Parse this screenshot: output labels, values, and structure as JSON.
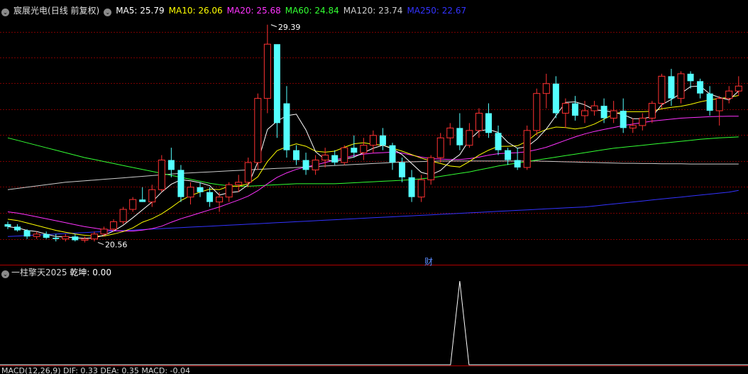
{
  "stock": {
    "name": "宸展光电",
    "period": "(日线 前复权)"
  },
  "ma_legend": [
    {
      "label": "MA5: 25.79",
      "color": "#ffffff"
    },
    {
      "label": "MA10: 26.06",
      "color": "#ffff00"
    },
    {
      "label": "MA20: 25.68",
      "color": "#ff33ff"
    },
    {
      "label": "MA60: 24.84",
      "color": "#33ff33"
    },
    {
      "label": "MA120: 23.74",
      "color": "#cccccc"
    },
    {
      "label": "MA250: 22.67",
      "color": "#3333ff"
    }
  ],
  "indicator": {
    "name": "一柱擎天2025",
    "value_label": "乾坤: 0.00"
  },
  "marker_cai": "财",
  "bottom_legend": "MACD(12,26,9)  DIF: 0.33  DEA: 0.35  MACD: -0.04",
  "colors": {
    "up": "#ff3232",
    "down": "#54ffff",
    "grid": "#7a0000",
    "bg": "#000000"
  },
  "chart_data": {
    "type": "candlestick",
    "ylim": [
      19.8,
      29.7
    ],
    "price_annotations": [
      {
        "label": "29.39",
        "price": 29.39,
        "bar": 27
      },
      {
        "label": "20.56",
        "price": 20.56,
        "bar": 9
      }
    ],
    "ohlc": [
      [
        21.3,
        21.4,
        21.1,
        21.2
      ],
      [
        21.2,
        21.3,
        21.0,
        21.05
      ],
      [
        21.05,
        21.1,
        20.7,
        20.8
      ],
      [
        20.8,
        21.0,
        20.7,
        20.9
      ],
      [
        20.9,
        21.0,
        20.7,
        20.75
      ],
      [
        20.75,
        20.9,
        20.6,
        20.7
      ],
      [
        20.7,
        20.9,
        20.6,
        20.8
      ],
      [
        20.8,
        20.9,
        20.6,
        20.65
      ],
      [
        20.65,
        20.8,
        20.56,
        20.7
      ],
      [
        20.7,
        21.0,
        20.6,
        20.9
      ],
      [
        20.9,
        21.2,
        20.8,
        21.1
      ],
      [
        21.1,
        21.5,
        21.0,
        21.4
      ],
      [
        21.4,
        22.0,
        21.3,
        21.9
      ],
      [
        21.9,
        22.4,
        21.8,
        22.3
      ],
      [
        22.3,
        22.8,
        22.2,
        22.2
      ],
      [
        22.2,
        22.9,
        22.0,
        22.7
      ],
      [
        22.7,
        24.1,
        22.6,
        23.9
      ],
      [
        23.9,
        24.4,
        23.2,
        23.5
      ],
      [
        23.5,
        23.7,
        22.2,
        22.4
      ],
      [
        22.4,
        23.0,
        22.1,
        22.8
      ],
      [
        22.8,
        23.0,
        22.4,
        22.6
      ],
      [
        22.6,
        22.8,
        22.0,
        22.2
      ],
      [
        22.2,
        22.6,
        21.8,
        22.4
      ],
      [
        22.4,
        23.0,
        22.2,
        22.9
      ],
      [
        22.9,
        23.3,
        22.6,
        23.0
      ],
      [
        23.0,
        24.0,
        22.8,
        23.8
      ],
      [
        23.8,
        26.6,
        23.5,
        26.4
      ],
      [
        26.4,
        29.39,
        25.8,
        28.6
      ],
      [
        28.6,
        27.2,
        24.8,
        25.4
      ],
      [
        26.2,
        26.9,
        24.0,
        24.3
      ],
      [
        24.3,
        24.5,
        23.7,
        23.9
      ],
      [
        23.9,
        24.2,
        23.3,
        23.5
      ],
      [
        23.5,
        24.1,
        23.3,
        23.9
      ],
      [
        23.9,
        24.4,
        23.6,
        24.1
      ],
      [
        24.1,
        24.3,
        23.7,
        23.8
      ],
      [
        23.8,
        24.5,
        23.7,
        24.4
      ],
      [
        24.4,
        24.9,
        24.0,
        24.2
      ],
      [
        24.2,
        24.8,
        23.9,
        24.5
      ],
      [
        24.5,
        25.1,
        24.2,
        24.9
      ],
      [
        24.9,
        25.2,
        24.3,
        24.5
      ],
      [
        24.5,
        24.6,
        23.5,
        23.8
      ],
      [
        23.8,
        24.0,
        23.0,
        23.2
      ],
      [
        23.2,
        23.5,
        22.2,
        22.4
      ],
      [
        22.4,
        23.3,
        22.2,
        23.1
      ],
      [
        23.1,
        24.1,
        22.9,
        24.0
      ],
      [
        24.0,
        25.0,
        23.8,
        24.8
      ],
      [
        24.8,
        25.4,
        24.5,
        25.2
      ],
      [
        25.2,
        25.8,
        24.3,
        24.5
      ],
      [
        24.5,
        25.4,
        24.4,
        25.1
      ],
      [
        25.1,
        26.0,
        24.8,
        25.8
      ],
      [
        25.8,
        26.2,
        24.8,
        25.0
      ],
      [
        25.0,
        25.3,
        24.1,
        24.3
      ],
      [
        24.3,
        24.4,
        23.7,
        23.9
      ],
      [
        23.9,
        24.4,
        23.5,
        23.6
      ],
      [
        23.6,
        25.3,
        23.5,
        25.1
      ],
      [
        25.1,
        26.8,
        24.9,
        26.6
      ],
      [
        26.6,
        27.4,
        26.0,
        27.0
      ],
      [
        27.0,
        27.3,
        25.6,
        25.8
      ],
      [
        25.8,
        26.4,
        25.2,
        26.2
      ],
      [
        26.2,
        26.5,
        25.5,
        25.7
      ],
      [
        25.7,
        26.3,
        25.4,
        25.9
      ],
      [
        25.9,
        26.3,
        25.7,
        26.1
      ],
      [
        26.1,
        26.4,
        25.4,
        25.6
      ],
      [
        25.6,
        26.3,
        25.4,
        25.9
      ],
      [
        25.9,
        26.4,
        25.0,
        25.2
      ],
      [
        25.2,
        25.6,
        25.0,
        25.3
      ],
      [
        25.3,
        25.8,
        25.1,
        25.6
      ],
      [
        25.6,
        26.3,
        25.4,
        26.2
      ],
      [
        26.2,
        27.4,
        26.0,
        27.3
      ],
      [
        27.3,
        27.6,
        26.1,
        26.4
      ],
      [
        26.4,
        27.5,
        26.2,
        27.4
      ],
      [
        27.4,
        27.5,
        26.8,
        27.1
      ],
      [
        27.1,
        27.2,
        26.4,
        26.6
      ],
      [
        26.6,
        26.9,
        25.7,
        25.9
      ],
      [
        25.9,
        26.5,
        25.3,
        26.4
      ],
      [
        26.4,
        26.9,
        26.2,
        26.7
      ],
      [
        26.7,
        27.3,
        26.5,
        26.9
      ]
    ],
    "ma5": [
      21.2,
      21.15,
      21.05,
      21.0,
      20.9,
      20.8,
      20.78,
      20.75,
      20.72,
      20.75,
      20.85,
      21.02,
      21.26,
      21.56,
      21.88,
      22.2,
      22.6,
      22.92,
      23.1,
      23.06,
      22.98,
      22.86,
      22.48,
      22.58,
      22.62,
      22.9,
      23.82,
      25.14,
      25.48,
      25.7,
      25.76,
      25.12,
      24.24,
      23.92,
      23.84,
      23.94,
      24.02,
      24.2,
      24.38,
      24.5,
      24.36,
      24.12,
      23.76,
      23.4,
      23.3,
      23.48,
      23.84,
      24.12,
      24.72,
      25.08,
      25.14,
      25.02,
      24.62,
      24.38,
      24.44,
      24.74,
      25.16,
      25.7,
      26.24,
      26.26,
      26.14,
      25.94,
      25.9,
      25.84,
      25.74,
      25.58,
      25.58,
      25.66,
      26.14,
      26.36,
      26.6,
      26.88,
      26.9,
      26.58,
      26.44,
      26.34,
      26.7
    ],
    "ma10": [
      21.5,
      21.45,
      21.35,
      21.25,
      21.15,
      21.05,
      20.97,
      20.9,
      20.85,
      20.82,
      20.82,
      20.9,
      21.0,
      21.15,
      21.38,
      21.52,
      21.72,
      21.98,
      22.26,
      22.46,
      22.6,
      22.72,
      22.7,
      22.84,
      22.84,
      22.94,
      23.22,
      23.84,
      24.28,
      24.44,
      24.56,
      24.46,
      24.26,
      24.22,
      24.26,
      24.42,
      24.56,
      24.6,
      24.54,
      24.5,
      24.38,
      24.26,
      24.12,
      23.98,
      23.86,
      23.76,
      23.66,
      23.62,
      23.84,
      24.1,
      24.3,
      24.46,
      24.46,
      24.48,
      24.66,
      24.98,
      25.14,
      25.24,
      25.22,
      25.16,
      25.22,
      25.36,
      25.56,
      25.76,
      25.86,
      25.86,
      25.86,
      25.88,
      25.98,
      26.04,
      26.08,
      26.16,
      26.26,
      26.34,
      26.4,
      26.44,
      26.52
    ],
    "ma20": [
      21.8,
      21.75,
      21.68,
      21.6,
      21.52,
      21.44,
      21.36,
      21.28,
      21.2,
      21.14,
      21.08,
      21.04,
      21.02,
      21.02,
      21.06,
      21.12,
      21.22,
      21.38,
      21.52,
      21.64,
      21.76,
      21.88,
      22.0,
      22.14,
      22.28,
      22.44,
      22.66,
      22.94,
      23.2,
      23.38,
      23.52,
      23.62,
      23.7,
      23.8,
      23.9,
      24.0,
      24.08,
      24.14,
      24.18,
      24.2,
      24.22,
      24.18,
      24.1,
      24.02,
      23.96,
      23.94,
      23.92,
      23.92,
      23.96,
      24.02,
      24.1,
      24.16,
      24.18,
      24.2,
      24.24,
      24.32,
      24.42,
      24.56,
      24.7,
      24.84,
      24.96,
      25.06,
      25.14,
      25.22,
      25.3,
      25.36,
      25.42,
      25.48,
      25.52,
      25.56,
      25.6,
      25.62,
      25.64,
      25.66,
      25.67,
      25.68,
      25.68
    ],
    "ma60": [
      24.8,
      24.7,
      24.6,
      24.5,
      24.4,
      24.3,
      24.2,
      24.1,
      24.0,
      23.92,
      23.84,
      23.76,
      23.68,
      23.6,
      23.52,
      23.44,
      23.36,
      23.28,
      23.2,
      23.12,
      23.04,
      22.96,
      22.9,
      22.86,
      22.84,
      22.84,
      22.86,
      22.88,
      22.9,
      22.92,
      22.94,
      22.94,
      22.94,
      22.94,
      22.94,
      22.96,
      22.98,
      23.0,
      23.02,
      23.04,
      23.06,
      23.08,
      23.1,
      23.14,
      23.18,
      23.24,
      23.3,
      23.36,
      23.42,
      23.5,
      23.58,
      23.66,
      23.72,
      23.78,
      23.84,
      23.9,
      23.96,
      24.02,
      24.08,
      24.14,
      24.2,
      24.26,
      24.32,
      24.38,
      24.42,
      24.46,
      24.5,
      24.54,
      24.58,
      24.62,
      24.66,
      24.7,
      24.74,
      24.77,
      24.8,
      24.82,
      24.84
    ],
    "ma120": [
      22.7,
      22.75,
      22.8,
      22.85,
      22.9,
      22.95,
      23.0,
      23.03,
      23.06,
      23.09,
      23.12,
      23.15,
      23.18,
      23.21,
      23.24,
      23.27,
      23.3,
      23.33,
      23.36,
      23.38,
      23.4,
      23.42,
      23.44,
      23.46,
      23.48,
      23.5,
      23.52,
      23.54,
      23.56,
      23.58,
      23.6,
      23.62,
      23.64,
      23.66,
      23.68,
      23.7,
      23.72,
      23.74,
      23.76,
      23.78,
      23.8,
      23.82,
      23.83,
      23.84,
      23.85,
      23.86,
      23.86,
      23.86,
      23.86,
      23.86,
      23.86,
      23.86,
      23.86,
      23.86,
      23.86,
      23.86,
      23.85,
      23.84,
      23.83,
      23.82,
      23.81,
      23.8,
      23.79,
      23.78,
      23.77,
      23.77,
      23.76,
      23.76,
      23.75,
      23.75,
      23.75,
      23.74,
      23.74,
      23.74,
      23.74,
      23.74,
      23.74
    ],
    "ma250": [
      20.8,
      20.82,
      20.84,
      20.86,
      20.88,
      20.9,
      20.92,
      20.94,
      20.96,
      20.98,
      21.0,
      21.02,
      21.04,
      21.06,
      21.08,
      21.1,
      21.12,
      21.14,
      21.16,
      21.18,
      21.2,
      21.22,
      21.24,
      21.26,
      21.28,
      21.3,
      21.32,
      21.34,
      21.36,
      21.38,
      21.4,
      21.42,
      21.44,
      21.46,
      21.48,
      21.5,
      21.52,
      21.54,
      21.56,
      21.58,
      21.6,
      21.62,
      21.64,
      21.66,
      21.68,
      21.7,
      21.72,
      21.74,
      21.76,
      21.78,
      21.8,
      21.82,
      21.84,
      21.86,
      21.88,
      21.9,
      21.92,
      21.94,
      21.96,
      21.98,
      22.0,
      22.04,
      22.08,
      22.12,
      22.16,
      22.2,
      22.24,
      22.28,
      22.32,
      22.36,
      22.4,
      22.44,
      22.48,
      22.52,
      22.56,
      22.6,
      22.67
    ],
    "signal": {
      "bar": 47,
      "value": 1,
      "max": 1
    }
  }
}
